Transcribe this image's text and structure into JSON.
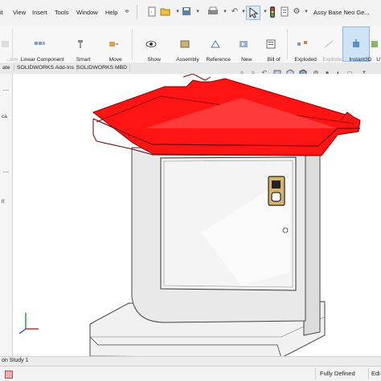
{
  "menu": {
    "items": [
      "it",
      "View",
      "Insert",
      "Tools",
      "Window",
      "Help"
    ],
    "document_title": "Assy Base Neo Ge..."
  },
  "ribbon": {
    "left_dim_label": "...ern\n...row",
    "buttons": [
      {
        "label": "Linear Component\nPattern",
        "icon": "pattern-icon"
      },
      {
        "label": "Smart\nFasteners",
        "icon": "fastener-icon"
      },
      {
        "label": "Move\nComponent",
        "icon": "move-icon"
      },
      {
        "label": "Show\nHidden\nComponents",
        "icon": "show-hidden-icon"
      },
      {
        "label": "Assembly\nFeatures",
        "icon": "assembly-features-icon"
      },
      {
        "label": "Reference\nGeometry",
        "icon": "reference-geometry-icon"
      },
      {
        "label": "New\nMotion\nStudy",
        "icon": "motion-study-icon"
      },
      {
        "label": "Bill of\nMaterials",
        "icon": "bom-icon"
      },
      {
        "label": "Exploded\nView",
        "icon": "exploded-view-icon"
      },
      {
        "label": "Explode\nLine\nSketch",
        "icon": "explode-line-icon",
        "dim": true
      },
      {
        "label": "Instant3D",
        "icon": "instant3d-icon",
        "active": true
      },
      {
        "label": "U\nS",
        "icon": "update-icon"
      }
    ]
  },
  "tabs": [
    "ate",
    "SOLIDWORKS Add-Ins",
    "SOLIDWORKS MBD"
  ],
  "left_panel": {
    "top_label": "ca",
    "mid_label": "lf"
  },
  "model": {
    "top_color": "#ff1414",
    "top_edge_color": "#8a0000",
    "body_color": "#e6e6e6",
    "door_color": "#f2f2f2"
  },
  "bottom": {
    "motion_tab": "on Study 1",
    "status_defined": "Fully Defined",
    "status_editing": "Edi"
  }
}
